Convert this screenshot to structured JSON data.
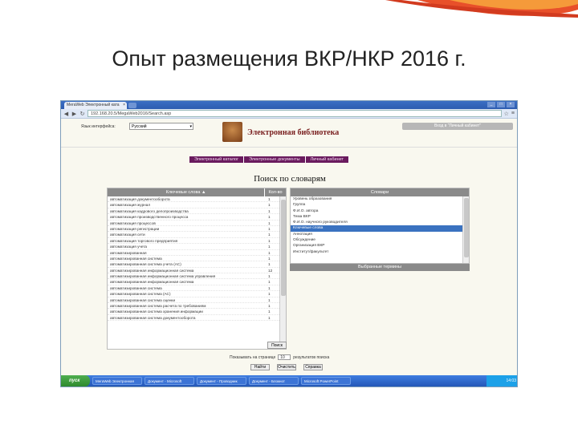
{
  "slide": {
    "title": "Опыт размещения ВКР/НКР 2016 г."
  },
  "browser": {
    "tab_title": "МегаWeb Электронный ката",
    "address": "192.168.20.5/MegaWeb2016/Search.asp",
    "back": "◀",
    "forward": "▶",
    "reload": "↻",
    "menu_icon": "≡",
    "star": "☆",
    "min": "_",
    "max": "□",
    "close": "×"
  },
  "header": {
    "lang_label": "Язык интерфейса:",
    "lang_value": "Русский",
    "title": "Электронная библиотека",
    "login": "Вход в \"Личный кабинет\""
  },
  "menu": [
    "Электронный каталог",
    "Электронные документы",
    "Личный кабинет"
  ],
  "search_title": "Поиск по словарям",
  "keywords": {
    "col_keyword": "Ключевые слова ▲",
    "col_count": "Кол-во",
    "rows": [
      {
        "t": "автоматизация документооборота",
        "c": "1"
      },
      {
        "t": "автоматизация журнал",
        "c": "1"
      },
      {
        "t": "автоматизация кадрового делопроизводства",
        "c": "1"
      },
      {
        "t": "автоматизация производственного процесса",
        "c": "1"
      },
      {
        "t": "автоматизация процессов",
        "c": "1"
      },
      {
        "t": "автоматизация регистрации",
        "c": "1"
      },
      {
        "t": "автоматизация сети",
        "c": "1"
      },
      {
        "t": "автоматизация торгового предприятия",
        "c": "1"
      },
      {
        "t": "автоматизация учета",
        "c": "1"
      },
      {
        "t": "автоматизированная",
        "c": "1"
      },
      {
        "t": "автоматизированная система",
        "c": "1"
      },
      {
        "t": "автоматизированная система учета (АС)",
        "c": "1"
      },
      {
        "t": "автоматизированная информационная система",
        "c": "12"
      },
      {
        "t": "автоматизированная информационная система управления",
        "c": "1"
      },
      {
        "t": "автоматизированная информационная система",
        "c": "1"
      },
      {
        "t": "автоматизированная система",
        "c": "1"
      },
      {
        "t": "автоматизированная система (АС)",
        "c": "1"
      },
      {
        "t": "автоматизированная система оценки",
        "c": "1"
      },
      {
        "t": "автоматизированная система расчета по требованиям",
        "c": "1"
      },
      {
        "t": "автоматизированная система хранения информации",
        "c": "1"
      },
      {
        "t": "автоматизированная система документооборота",
        "c": "1"
      }
    ],
    "search_button": "Поиск"
  },
  "dictionaries": {
    "header": "Словари",
    "rows": [
      "Уровень образования",
      "Группа",
      "Ф.И.О. автора",
      "Тема ВКР",
      "Ф.И.О. научного руководителя",
      "Ключевые слова",
      "Аннотация",
      "Обсуждение",
      "Организация ВКР",
      "Институт/факультет"
    ],
    "selected_index": 5,
    "chosen_header": "Выбранные термины"
  },
  "results": {
    "per_page_label": "Показывать на странице",
    "per_page_value": "10",
    "per_page_suffix": "результатов поиска",
    "buttons": [
      "Найти",
      "Очистить",
      "Справка"
    ]
  },
  "taskbar": {
    "start": "пуск",
    "items": [
      "МегаWeb Электронная",
      "Документ - Microsoft",
      "Документ - Проводник",
      "Документ - Блокнот",
      "Microsoft PowerPoint"
    ],
    "clock": "14:03"
  }
}
